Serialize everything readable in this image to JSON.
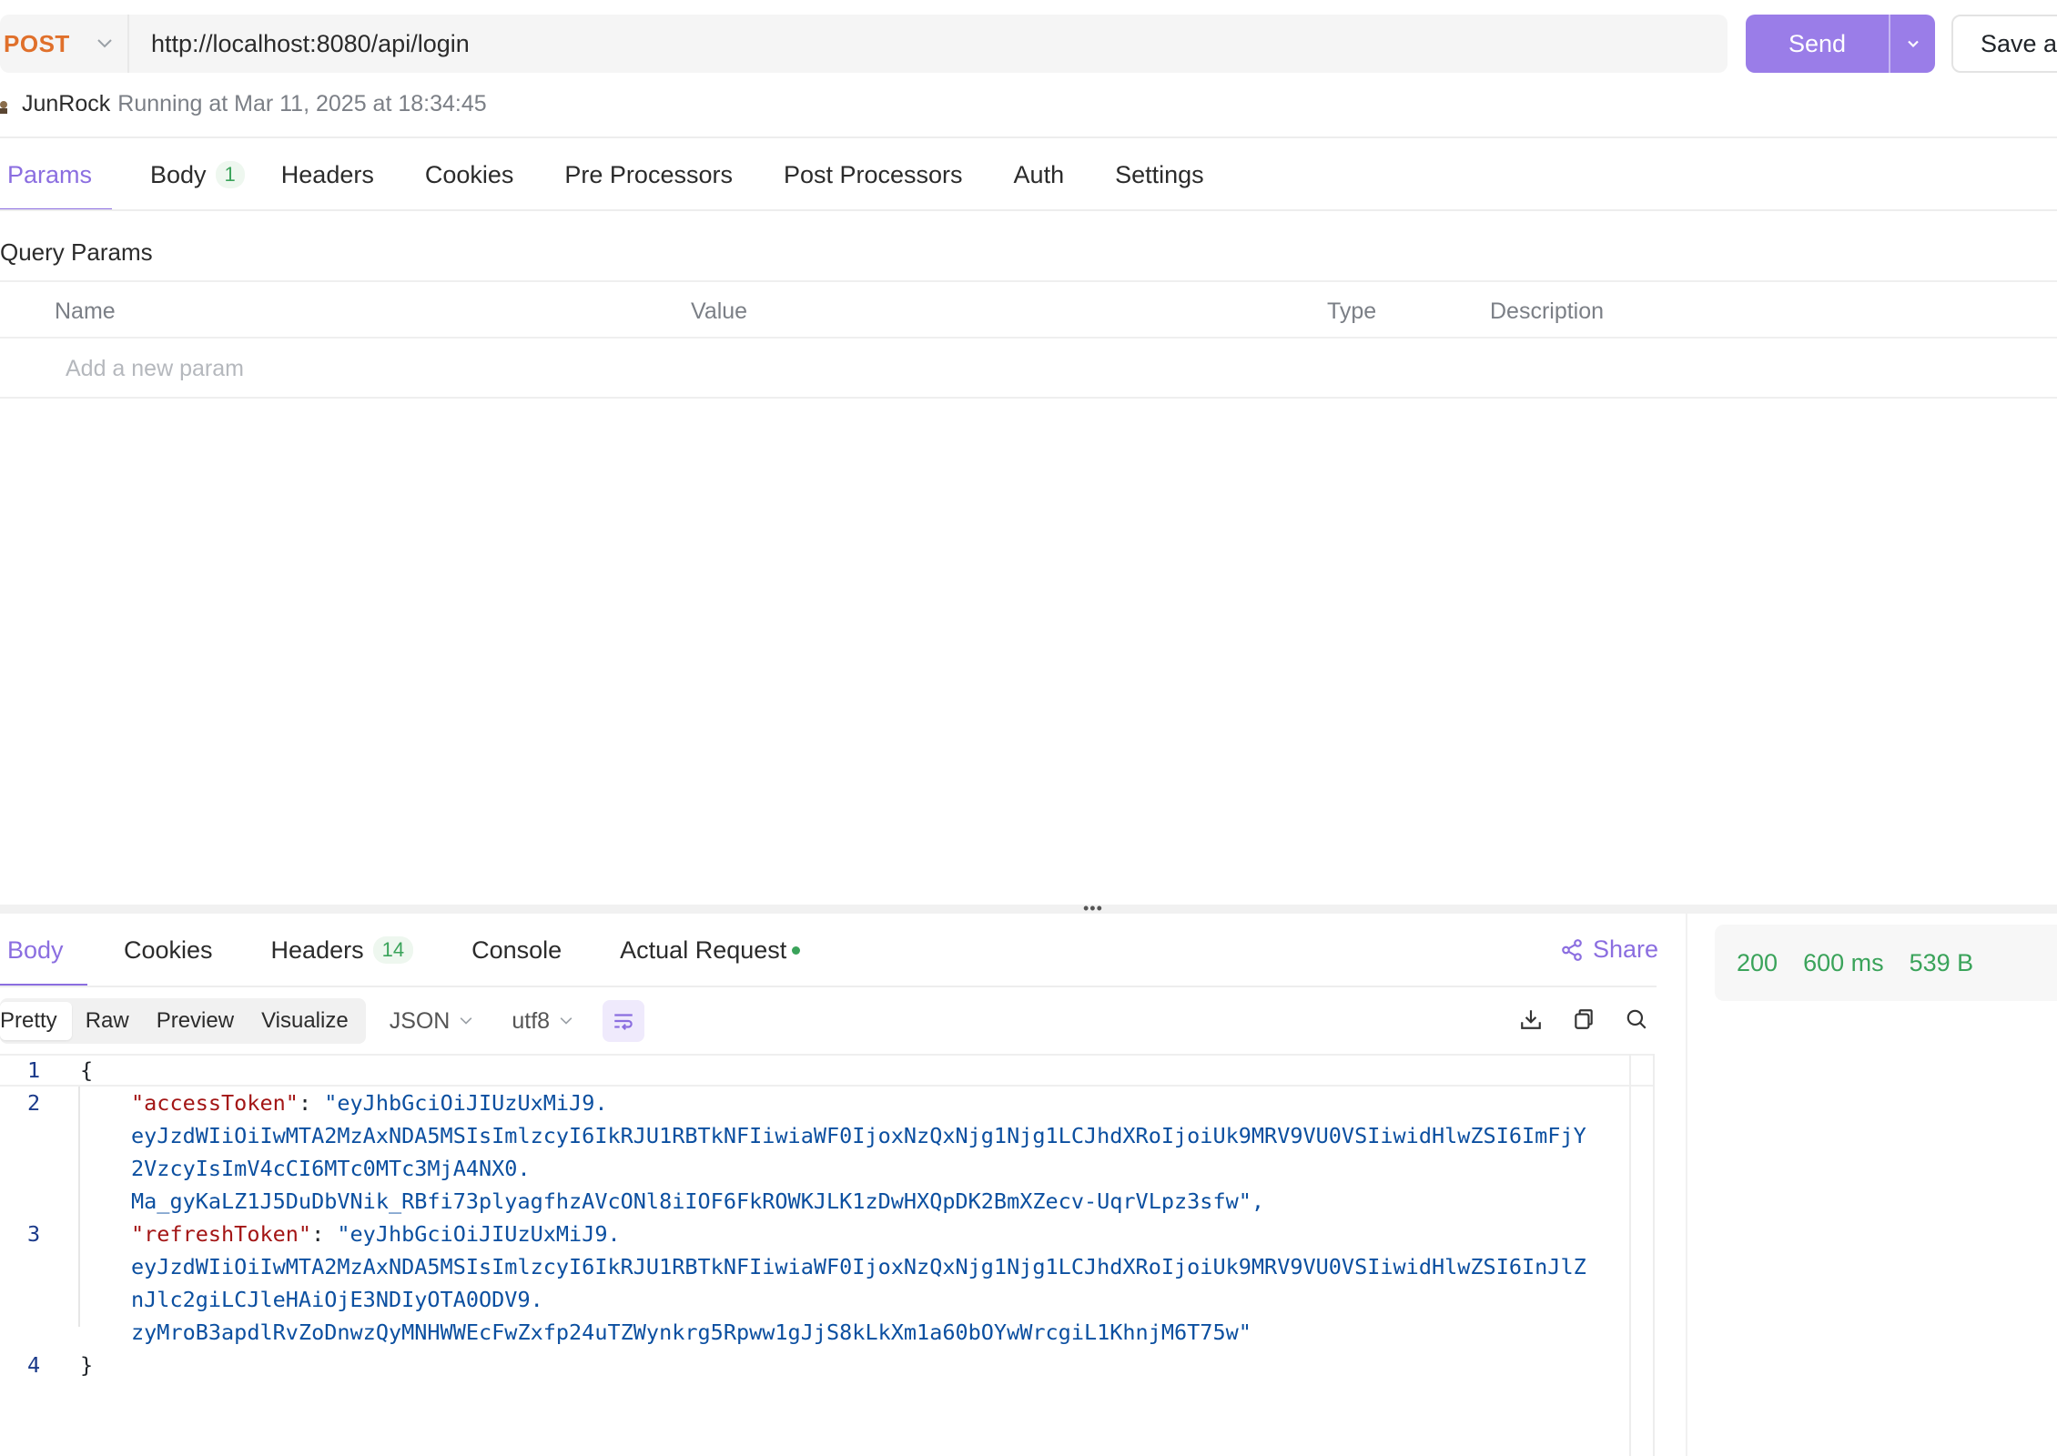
{
  "request": {
    "method": "POST",
    "url": "http://localhost:8080/api/login",
    "send_label": "Send",
    "save_label": "Save as"
  },
  "run": {
    "user": "JunRock",
    "status": "Running at Mar 11, 2025 at 18:34:45"
  },
  "request_tabs": [
    {
      "label": "Params"
    },
    {
      "label": "Body",
      "count": "1"
    },
    {
      "label": "Headers"
    },
    {
      "label": "Cookies"
    },
    {
      "label": "Pre Processors"
    },
    {
      "label": "Post Processors"
    },
    {
      "label": "Auth"
    },
    {
      "label": "Settings"
    }
  ],
  "query_params": {
    "title": "Query Params",
    "columns": [
      "Name",
      "Value",
      "Type",
      "Description"
    ],
    "add_placeholder": "Add a new param"
  },
  "response_tabs": [
    {
      "label": "Body"
    },
    {
      "label": "Cookies"
    },
    {
      "label": "Headers",
      "count": "14"
    },
    {
      "label": "Console"
    },
    {
      "label": "Actual Request"
    }
  ],
  "share_label": "Share",
  "stats": {
    "status_code": "200",
    "time": "600 ms",
    "size": "539 B"
  },
  "view_modes": [
    "Pretty",
    "Raw",
    "Preview",
    "Visualize"
  ],
  "format_select": "JSON",
  "encoding_select": "utf8",
  "code": {
    "line_numbers": [
      "1",
      "2",
      "3",
      "4"
    ],
    "open_brace": "{",
    "close_brace": "}",
    "access_key": "\"accessToken\"",
    "access_val_1": "\"eyJhbGciOiJIUzUxMiJ9.",
    "access_val_2": "eyJzdWIiOiIwMTA2MzAxNDA5MSIsImlzcyI6IkRJU1RBTkNFIiwiaWF0IjoxNzQxNjg1Njg1LCJhdXRoIjoiUk9MRV9VU0VSIiwidHlwZSI6ImFjY",
    "access_val_3": "2VzcyIsImV4cCI6MTc0MTc3MjA4NX0.",
    "access_val_4": "Ma_gyKaLZ1J5DuDbVNik_RBfi73plyagfhzAVcONl8iIOF6FkROWKJLK1zDwHXQpDK2BmXZecv-UqrVLpz3sfw\",",
    "refresh_key": "\"refreshToken\"",
    "refresh_val_1": "\"eyJhbGciOiJIUzUxMiJ9.",
    "refresh_val_2": "eyJzdWIiOiIwMTA2MzAxNDA5MSIsImlzcyI6IkRJU1RBTkNFIiwiaWF0IjoxNzQxNjg1Njg1LCJhdXRoIjoiUk9MRV9VU0VSIiwidHlwZSI6InJlZ",
    "refresh_val_3": "nJlc2giLCJleHAiOjE3NDIyOTA0ODV9.",
    "refresh_val_4": "zyMroB3apdlRvZoDnwzQyMNHWWEcFwZxfp24uTZWynkrg5Rpww1gJjS8kLkXm1a60bOYwWrcgiL1KhnjM6T75w\""
  },
  "colors": {
    "accent": "#8b6ee0",
    "send_button": "#9a7de8",
    "method": "#e0702b",
    "success": "#3aa35a"
  }
}
